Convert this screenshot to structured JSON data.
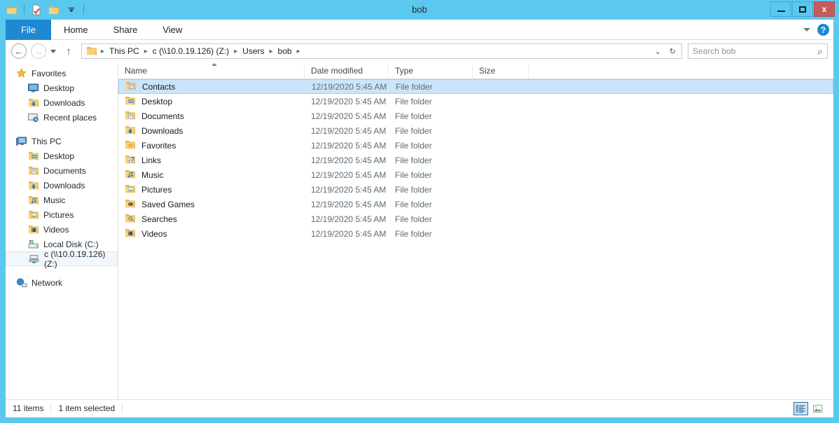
{
  "window": {
    "title": "bob",
    "controls": {
      "minimize": "–",
      "maximize": "□",
      "close": "x"
    }
  },
  "quick_access_toolbar": {
    "items": [
      {
        "name": "folder-icon",
        "label": "Folder"
      },
      {
        "name": "properties-icon",
        "label": "Properties"
      },
      {
        "name": "new-folder-icon",
        "label": "New folder"
      },
      {
        "name": "customize-dropdown-icon",
        "label": "Customize Quick Access Toolbar"
      }
    ]
  },
  "ribbon": {
    "tabs": [
      {
        "label": "File",
        "active": true
      },
      {
        "label": "Home",
        "active": false
      },
      {
        "label": "Share",
        "active": false
      },
      {
        "label": "View",
        "active": false
      }
    ],
    "minimize_ribbon_icon": "chevron-down-icon",
    "help_icon": "help-icon",
    "help_glyph": "?"
  },
  "address_bar": {
    "back_glyph": "←",
    "forward_glyph": "→",
    "recent_glyph": "▾",
    "up_glyph": "↑",
    "folder_icon": "folder-icon",
    "breadcrumbs": [
      "This PC",
      "c (\\\\10.0.19.126) (Z:)",
      "Users",
      "bob"
    ],
    "separator": "▸",
    "history_glyph": "⌄",
    "refresh_glyph": "↻"
  },
  "search": {
    "placeholder": "Search bob",
    "value": "",
    "icon": "search-icon",
    "icon_glyph": "⌕"
  },
  "nav_pane": {
    "groups": [
      {
        "header": {
          "label": "Favorites",
          "icon": "star-icon"
        },
        "items": [
          {
            "label": "Desktop",
            "icon": "desktop-icon"
          },
          {
            "label": "Downloads",
            "icon": "downloads-folder-icon"
          },
          {
            "label": "Recent places",
            "icon": "recent-places-icon"
          }
        ]
      },
      {
        "header": {
          "label": "This PC",
          "icon": "computer-icon"
        },
        "items": [
          {
            "label": "Desktop",
            "icon": "desktop-folder-icon"
          },
          {
            "label": "Documents",
            "icon": "documents-folder-icon"
          },
          {
            "label": "Downloads",
            "icon": "downloads-folder-icon"
          },
          {
            "label": "Music",
            "icon": "music-folder-icon"
          },
          {
            "label": "Pictures",
            "icon": "pictures-folder-icon"
          },
          {
            "label": "Videos",
            "icon": "videos-folder-icon"
          },
          {
            "label": "Local Disk (C:)",
            "icon": "local-disk-icon"
          },
          {
            "label": "c (\\\\10.0.19.126) (Z:)",
            "icon": "network-drive-icon",
            "selected": true
          }
        ]
      },
      {
        "header": {
          "label": "Network",
          "icon": "network-icon"
        },
        "items": []
      }
    ]
  },
  "file_list": {
    "columns": [
      {
        "label": "Name",
        "sorted": true,
        "sort_direction": "asc"
      },
      {
        "label": "Date modified",
        "sorted": false
      },
      {
        "label": "Type",
        "sorted": false
      },
      {
        "label": "Size",
        "sorted": false
      }
    ],
    "rows": [
      {
        "name": "Contacts",
        "date": "12/19/2020 5:45 AM",
        "type": "File folder",
        "size": "",
        "icon": "contacts-folder-icon",
        "selected": true
      },
      {
        "name": "Desktop",
        "date": "12/19/2020 5:45 AM",
        "type": "File folder",
        "size": "",
        "icon": "desktop-folder-icon",
        "selected": false
      },
      {
        "name": "Documents",
        "date": "12/19/2020 5:45 AM",
        "type": "File folder",
        "size": "",
        "icon": "documents-folder-icon",
        "selected": false
      },
      {
        "name": "Downloads",
        "date": "12/19/2020 5:45 AM",
        "type": "File folder",
        "size": "",
        "icon": "downloads-folder-icon",
        "selected": false
      },
      {
        "name": "Favorites",
        "date": "12/19/2020 5:45 AM",
        "type": "File folder",
        "size": "",
        "icon": "favorites-folder-icon",
        "selected": false
      },
      {
        "name": "Links",
        "date": "12/19/2020 5:45 AM",
        "type": "File folder",
        "size": "",
        "icon": "links-folder-icon",
        "selected": false
      },
      {
        "name": "Music",
        "date": "12/19/2020 5:45 AM",
        "type": "File folder",
        "size": "",
        "icon": "music-folder-icon",
        "selected": false
      },
      {
        "name": "Pictures",
        "date": "12/19/2020 5:45 AM",
        "type": "File folder",
        "size": "",
        "icon": "pictures-folder-icon",
        "selected": false
      },
      {
        "name": "Saved Games",
        "date": "12/19/2020 5:45 AM",
        "type": "File folder",
        "size": "",
        "icon": "saved-games-folder-icon",
        "selected": false
      },
      {
        "name": "Searches",
        "date": "12/19/2020 5:45 AM",
        "type": "File folder",
        "size": "",
        "icon": "searches-folder-icon",
        "selected": false
      },
      {
        "name": "Videos",
        "date": "12/19/2020 5:45 AM",
        "type": "File folder",
        "size": "",
        "icon": "videos-folder-icon",
        "selected": false
      }
    ]
  },
  "status_bar": {
    "item_count": "11 items",
    "selection": "1 item selected",
    "views": [
      {
        "name": "details-view-button",
        "active": true
      },
      {
        "name": "large-icons-view-button",
        "active": false
      }
    ]
  },
  "colors": {
    "window_frame": "#5BC8EF",
    "file_tab": "#1E88D3",
    "selection": "#CCE4FA",
    "close_button": "#C75B5B",
    "folder_yellow": "#F5C45A"
  }
}
